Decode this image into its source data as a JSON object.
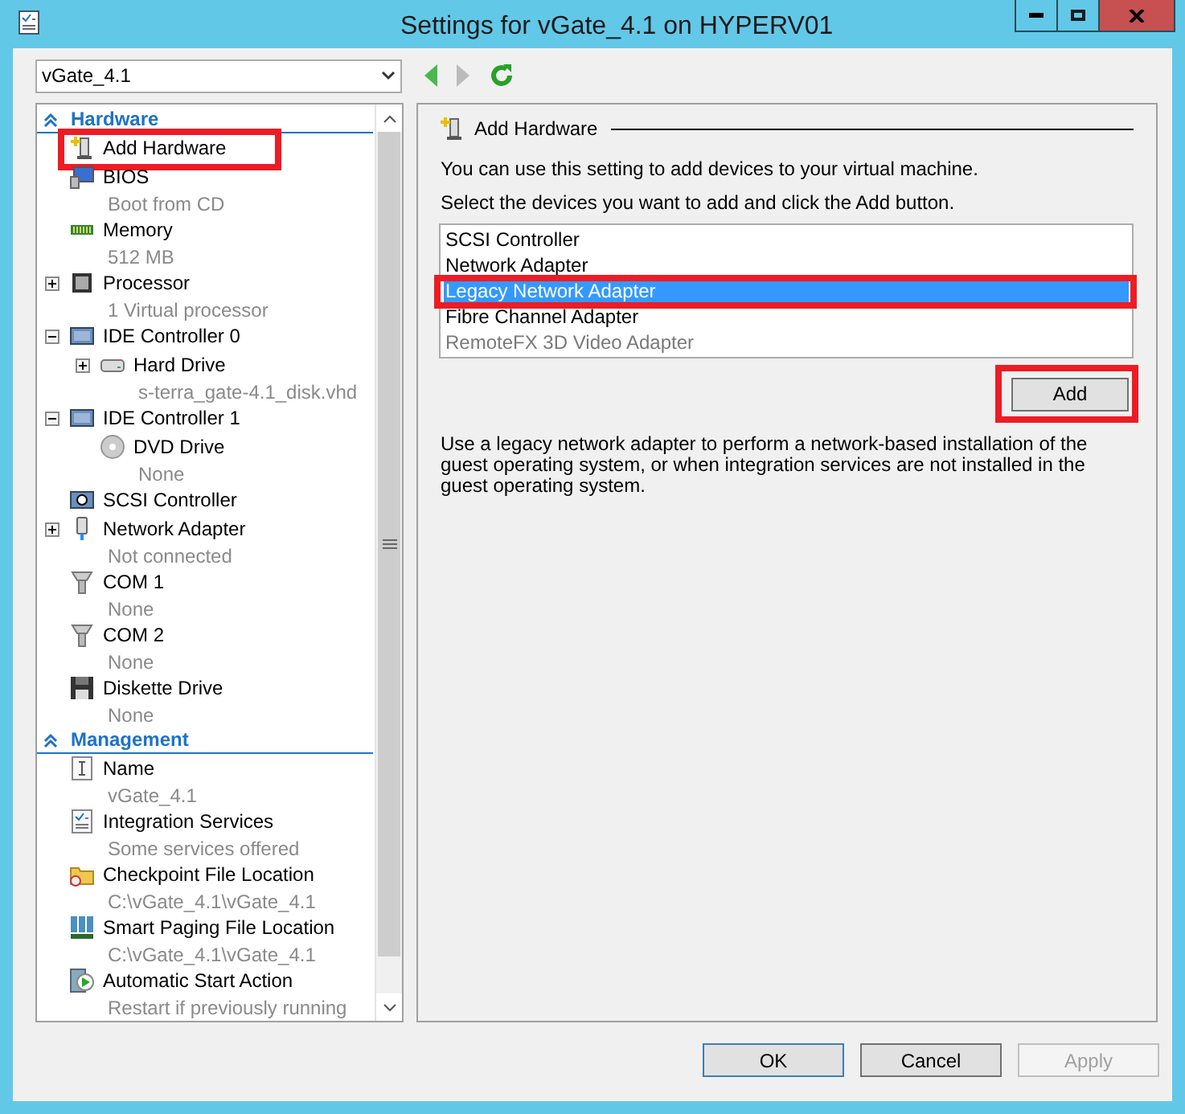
{
  "window": {
    "title": "Settings for vGate_4.1 on HYPERV01"
  },
  "vm_selector": {
    "value": "vGate_4.1"
  },
  "tree": {
    "sections": [
      {
        "title": "Hardware",
        "expanded": true,
        "items": [
          {
            "name": "Add Hardware",
            "selected": false,
            "annotated": true
          },
          {
            "name": "BIOS",
            "detail": "Boot from CD",
            "selected": false
          },
          {
            "name": "Memory",
            "detail": "512 MB",
            "selected": false
          },
          {
            "name": "Processor",
            "detail": "1 Virtual processor",
            "expanded": false,
            "selected": false
          },
          {
            "name": "IDE Controller 0",
            "expanded": true,
            "selected": false,
            "children": [
              {
                "name": "Hard Drive",
                "detail": "s-terra_gate-4.1_disk.vhd",
                "expanded": false,
                "selected": false
              }
            ]
          },
          {
            "name": "IDE Controller 1",
            "expanded": true,
            "selected": false,
            "children": [
              {
                "name": "DVD Drive",
                "detail": "None",
                "selected": false
              }
            ]
          },
          {
            "name": "SCSI Controller",
            "selected": false
          },
          {
            "name": "Network Adapter",
            "detail": "Not connected",
            "expanded": false,
            "selected": false
          },
          {
            "name": "COM 1",
            "detail": "None",
            "selected": false
          },
          {
            "name": "COM 2",
            "detail": "None",
            "selected": false
          },
          {
            "name": "Diskette Drive",
            "detail": "None",
            "selected": false
          }
        ]
      },
      {
        "title": "Management",
        "expanded": true,
        "items": [
          {
            "name": "Name",
            "detail": "vGate_4.1",
            "selected": false
          },
          {
            "name": "Integration Services",
            "detail": "Some services offered",
            "selected": false
          },
          {
            "name": "Checkpoint File Location",
            "detail": "C:\\vGate_4.1\\vGate_4.1",
            "selected": false
          },
          {
            "name": "Smart Paging File Location",
            "detail": "C:\\vGate_4.1\\vGate_4.1",
            "selected": false
          },
          {
            "name": "Automatic Start Action",
            "detail": "Restart if previously running",
            "selected": false
          }
        ]
      }
    ]
  },
  "panel": {
    "title": "Add Hardware",
    "intro": "You can use this setting to add devices to your virtual machine.",
    "prompt": "Select the devices you want to add and click the Add button.",
    "devices": [
      {
        "label": "SCSI Controller",
        "selected": false,
        "disabled": false,
        "annotated": false
      },
      {
        "label": "Network Adapter",
        "selected": false,
        "disabled": false,
        "annotated": false
      },
      {
        "label": "Legacy Network Adapter",
        "selected": true,
        "disabled": false,
        "annotated": true
      },
      {
        "label": "Fibre Channel Adapter",
        "selected": false,
        "disabled": false,
        "annotated": false
      },
      {
        "label": "RemoteFX 3D Video Adapter",
        "selected": false,
        "disabled": true,
        "annotated": false
      }
    ],
    "add_button": {
      "label": "Add",
      "annotated": true
    },
    "description": "Use a legacy network adapter to perform a network-based installation of the guest operating system, or when integration services are not installed in the guest operating system."
  },
  "buttons": [
    {
      "label": "OK",
      "disabled": false,
      "default": true
    },
    {
      "label": "Cancel",
      "disabled": false,
      "default": false
    },
    {
      "label": "Apply",
      "disabled": true,
      "default": false
    }
  ]
}
